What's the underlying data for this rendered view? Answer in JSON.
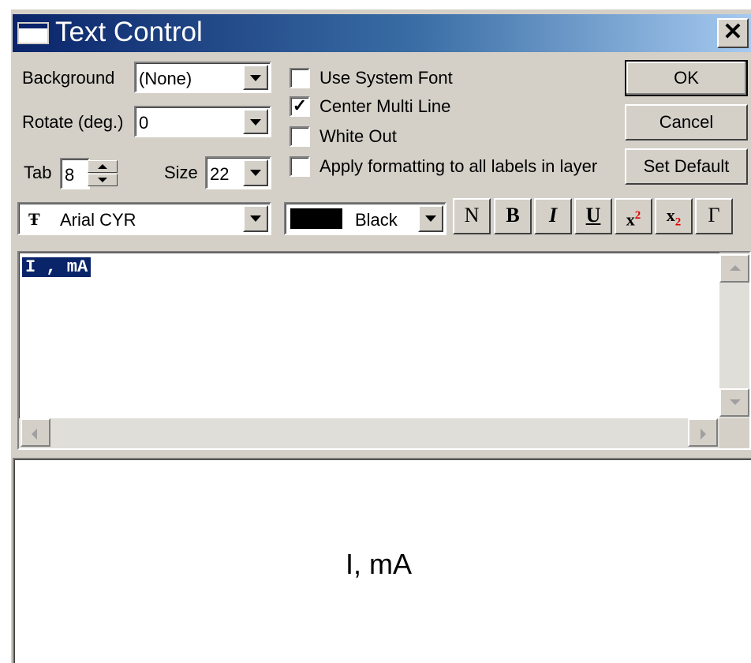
{
  "window": {
    "title": "Text Control",
    "close_glyph": "✕"
  },
  "background": {
    "label": "Background",
    "value": "(None)"
  },
  "rotate": {
    "label": "Rotate (deg.)",
    "value": "0"
  },
  "tab": {
    "label": "Tab",
    "value": "8"
  },
  "size": {
    "label": "Size",
    "value": "22"
  },
  "checkboxes": [
    {
      "label": "Use System Font",
      "checked": false
    },
    {
      "label": "Center Multi Line",
      "checked": true
    },
    {
      "label": "White Out",
      "checked": false
    },
    {
      "label": "Apply formatting to all labels in layer",
      "checked": false
    }
  ],
  "check_mark": "✓",
  "buttons": {
    "ok": "OK",
    "cancel": "Cancel",
    "set_default": "Set Default"
  },
  "font": {
    "icon": "truetype-font-icon",
    "glyph": "Ŧ",
    "value": "Arial CYR"
  },
  "color": {
    "value": "Black",
    "swatch": "#000000"
  },
  "format_buttons": {
    "normal": "N",
    "bold": "B",
    "italic": "I",
    "underline": "U",
    "superscript_base": "x",
    "superscript_exp": "2",
    "subscript_base": "x",
    "subscript_exp": "2",
    "greek": "Γ"
  },
  "editor": {
    "text": "I , mA"
  },
  "preview": {
    "text": "I, mA"
  },
  "colors": {
    "title_start": "#0a246a",
    "title_end": "#a6caf0",
    "face": "#d4d0c8",
    "selection": "#0a246a",
    "exponent_red": "#e00000"
  }
}
